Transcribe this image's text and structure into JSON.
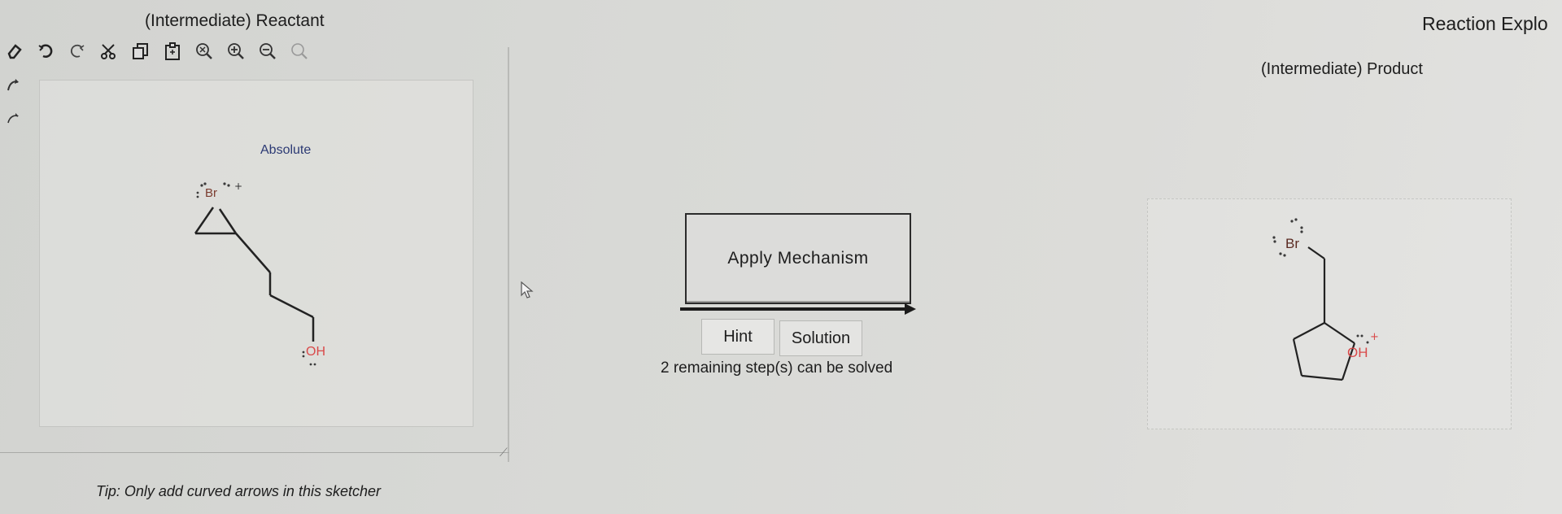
{
  "reactant": {
    "title": "(Intermediate) Reactant",
    "stereo_label": "Absolute",
    "atoms": {
      "br": "Br",
      "oh": "OH"
    },
    "tip": "Tip: Only add curved arrows in this sketcher"
  },
  "header": {
    "reaction_explorer": "Reaction Explo"
  },
  "toolbar": {
    "tools": [
      "eraser-icon",
      "undo-icon",
      "redo-icon",
      "cut-icon",
      "copy-icon",
      "paste-icon",
      "zoom-clear-icon",
      "zoom-in-icon",
      "zoom-out-icon",
      "zoom-fit-icon"
    ]
  },
  "center": {
    "apply_label": "Apply Mechanism",
    "hint_label": "Hint",
    "solution_label": "Solution",
    "remaining_text": "2 remaining step(s) can be solved"
  },
  "product": {
    "title": "(Intermediate) Product",
    "atoms": {
      "br": "Br",
      "oh": "OH"
    }
  },
  "colors": {
    "bromine": "#7a3b2e",
    "oxygen": "#d94a4a",
    "label_blue": "#2c3a74",
    "lone_pair": "#3a3a3a"
  }
}
